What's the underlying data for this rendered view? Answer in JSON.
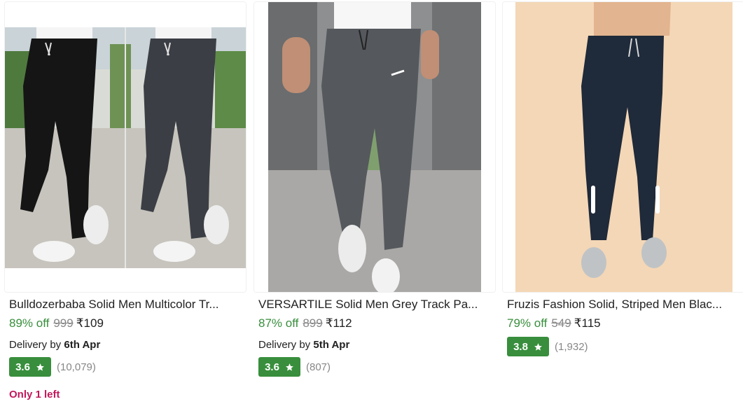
{
  "products": [
    {
      "title": "Bulldozerbaba Solid Men Multicolor Tr...",
      "discount": "89% off",
      "mrp": "999",
      "price": "₹109",
      "delivery_prefix": "Delivery by",
      "delivery_date": "6th Apr",
      "rating": "3.6",
      "rating_count": "(10,079)",
      "stock_note": "Only 1 left",
      "image": "two-track-pants-black-grey"
    },
    {
      "title": "VERSARTILE Solid Men Grey Track Pa...",
      "discount": "87% off",
      "mrp": "899",
      "price": "₹112",
      "delivery_prefix": "Delivery by",
      "delivery_date": "5th Apr",
      "rating": "3.6",
      "rating_count": "(807)",
      "image": "grey-track-pants-street"
    },
    {
      "title": "Fruzis Fashion Solid, Striped Men Blac...",
      "discount": "79% off",
      "mrp": "549",
      "price": "₹115",
      "rating": "3.8",
      "rating_count": "(1,932)",
      "image": "navy-striped-track-pants"
    }
  ],
  "icons": {
    "rating_star": "star-icon"
  },
  "colors": {
    "discount": "#388e3c",
    "rating_badge": "#388e3c",
    "stock_note": "#c2185b",
    "mrp": "#878787"
  }
}
